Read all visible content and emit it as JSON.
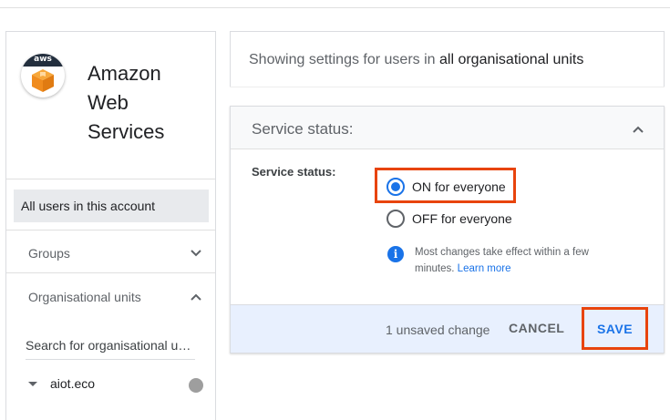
{
  "app": {
    "name": "Amazon Web Services",
    "logo_text": "aws"
  },
  "sidebar": {
    "all_users": "All users in this account",
    "groups_label": "Groups",
    "org_units_label": "Organisational units",
    "search_placeholder": "Search for organisational units",
    "org_units": [
      {
        "label": "aiot.eco"
      }
    ]
  },
  "info_banner": {
    "prefix": "Showing settings for users in",
    "scope": "all organisational units"
  },
  "service_card": {
    "title": "Service status:",
    "field_label": "Service status:",
    "options": [
      {
        "label": "ON for everyone",
        "selected": true
      },
      {
        "label": "OFF for everyone",
        "selected": false
      }
    ],
    "note": "Most changes take effect within a few minutes.",
    "note_link": "Learn more"
  },
  "footer": {
    "unsaved_text": "1 unsaved change",
    "cancel_label": "CANCEL",
    "save_label": "SAVE"
  },
  "colors": {
    "accent": "#1a73e8",
    "highlight": "#e8440d",
    "footer_bg": "#e8f0fe"
  }
}
